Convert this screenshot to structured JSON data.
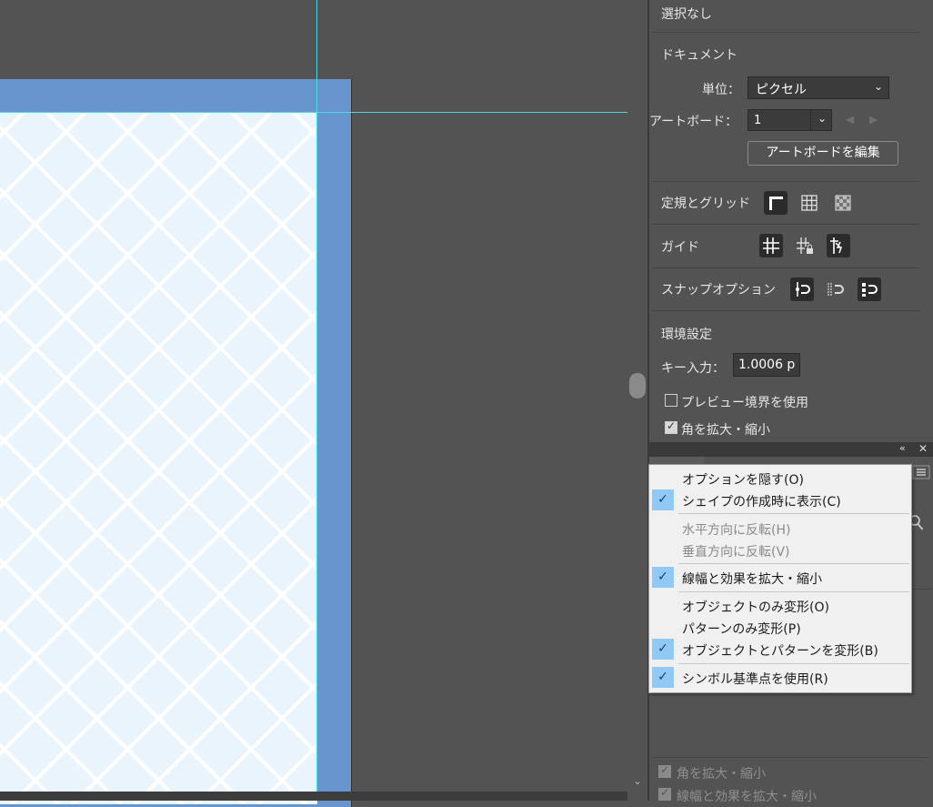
{
  "panel": {
    "selection_status": "選択なし",
    "document_section": "ドキュメント",
    "units_label": "単位：",
    "units_value": "ピクセル",
    "artboard_label": "アートボード：",
    "artboard_value": "1",
    "edit_artboard_button": "アートボードを編集",
    "rulers_grids_label": "定規とグリッド",
    "guides_label": "ガイド",
    "snap_options_label": "スナップオプション",
    "preferences_section": "環境設定",
    "key_input_label": "キー入力：",
    "key_input_value": "1.0006 p",
    "use_preview_bounds": "プレビュー境界を使用",
    "scale_corners": "角を拡大・縮小"
  },
  "lower_panel": {
    "collapse_icon": "«",
    "close_icon": "✕",
    "scale_corners_dim": "角を拡大・縮小",
    "scale_strokes_dim": "線幅と効果を拡大・縮小"
  },
  "menu": {
    "items": [
      {
        "label": "オプションを隠す(O)",
        "checked": false,
        "disabled": false
      },
      {
        "label": "シェイプの作成時に表示(C)",
        "checked": true,
        "disabled": false
      },
      {
        "label": "水平方向に反転(H)",
        "checked": false,
        "disabled": true
      },
      {
        "label": "垂直方向に反転(V)",
        "checked": false,
        "disabled": true
      },
      {
        "label": "線幅と効果を拡大・縮小",
        "checked": true,
        "disabled": false
      },
      {
        "label": "オブジェクトのみ変形(O)",
        "checked": false,
        "disabled": false
      },
      {
        "label": "パターンのみ変形(P)",
        "checked": false,
        "disabled": false
      },
      {
        "label": "オブジェクトとパターンを変形(B)",
        "checked": true,
        "disabled": false
      },
      {
        "label": "シンボル基準点を使用(R)",
        "checked": true,
        "disabled": false
      }
    ],
    "check_glyph": "✓"
  },
  "colors": {
    "guide": "#4fd8e6",
    "artboard_border": "#6795cd",
    "artboard_fill": "#eaf4fd",
    "menu_check_bg": "#90c8f6"
  }
}
